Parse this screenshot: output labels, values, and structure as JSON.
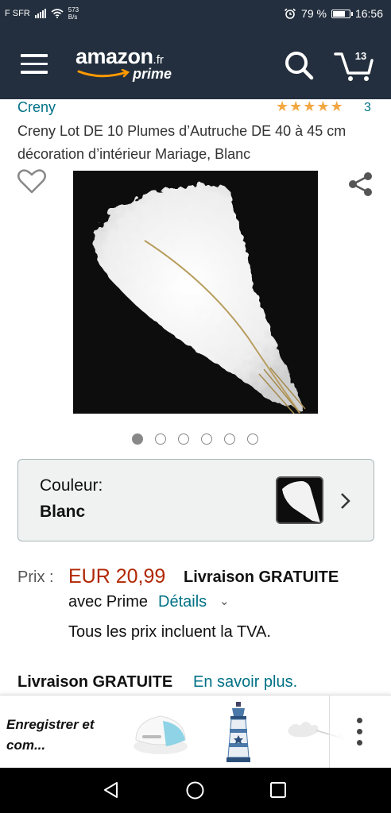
{
  "status_bar": {
    "carrier": "F SFR",
    "speed_value": "573",
    "speed_unit": "B/s",
    "battery": "79 %",
    "battery_level": 0.79,
    "time": "16:56"
  },
  "header": {
    "logo_word": "amazon",
    "logo_tld": ".fr",
    "logo_prime": "prime",
    "cart_count": "13",
    "icons": [
      "menu-icon",
      "search-icon",
      "cart-icon"
    ]
  },
  "product": {
    "brand": "Creny",
    "rating": 5,
    "rating_count": "3",
    "title": "Creny Lot DE 10 Plumes d’Autruche DE 40 à 45 cm décoration d’intérieur Mariage, Blanc",
    "image_count": 6,
    "active_image": 0
  },
  "color": {
    "label": "Couleur:",
    "value": "Blanc"
  },
  "price": {
    "label": "Prix :",
    "value": "EUR 20,99",
    "shipping": "Livraison GRATUITE",
    "with_prime": "avec Prime",
    "details": "Détails",
    "tax_note": "Tous les prix incluent la TVA."
  },
  "delivery": {
    "label": "Livraison GRATUITE",
    "link": "En savoir plus."
  },
  "recommendations": {
    "save_label": "Enregistrer et com..."
  },
  "colors": {
    "header_bg": "#232f3e",
    "link": "#007185",
    "price": "#b12704",
    "star": "#f2a742"
  }
}
